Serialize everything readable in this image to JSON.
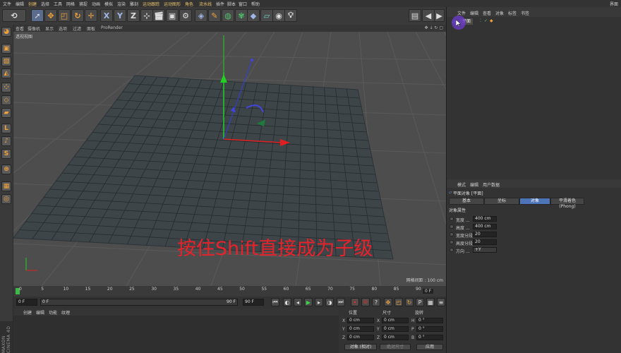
{
  "menu": {
    "items": [
      "文件",
      "编辑",
      "创建",
      "选择",
      "工具",
      "网格",
      "捕捉",
      "动画",
      "模拟",
      "渲染",
      "雕刻",
      "运动跟踪",
      "运动图形",
      "角色",
      "流水线",
      "插件",
      "脚本",
      "窗口",
      "帮助"
    ],
    "layout_label": "界面"
  },
  "toolbar": {
    "undo": "⟲",
    "x": "X",
    "y": "Y",
    "z": "Z"
  },
  "viewport": {
    "menu": [
      "查看",
      "摄像机",
      "显示",
      "选项",
      "过滤",
      "面板",
      "ProRender"
    ],
    "label": "透视视图",
    "grid_spacing": "网格间距 : 100 cm",
    "caption": "按住Shift直接成为子级"
  },
  "timeline": {
    "ticks": [
      "0",
      "5",
      "10",
      "15",
      "20",
      "25",
      "30",
      "35",
      "40",
      "45",
      "50",
      "55",
      "60",
      "65",
      "70",
      "75",
      "80",
      "85",
      "90"
    ],
    "end_frame": "0 F"
  },
  "playback": {
    "current": "0 F",
    "start": "0 F",
    "end": "90 F",
    "max": "90 F"
  },
  "material_manager": {
    "menu": [
      "创建",
      "编辑",
      "功能",
      "纹理"
    ]
  },
  "coordinates": {
    "headers": [
      "位置",
      "尺寸",
      "旋转"
    ],
    "rows": [
      {
        "axis": "X",
        "pos": "0 cm",
        "size_axis": "X",
        "size": "0 cm",
        "rot_axis": "H",
        "rot": "0 °"
      },
      {
        "axis": "Y",
        "pos": "0 cm",
        "size_axis": "Y",
        "size": "0 cm",
        "rot_axis": "P",
        "rot": "0 °"
      },
      {
        "axis": "Z",
        "pos": "0 cm",
        "size_axis": "Z",
        "size": "0 cm",
        "rot_axis": "B",
        "rot": "0 °"
      }
    ],
    "mode": "对象 (相对)",
    "size_mode": "绝对尺寸",
    "apply": "应用"
  },
  "object_manager": {
    "menu": [
      "文件",
      "编辑",
      "查看",
      "对象",
      "标签",
      "书签"
    ],
    "object_name": "平面"
  },
  "attribute_manager": {
    "menu": [
      "模式",
      "编辑",
      "用户数据"
    ],
    "title": "平面对象 [平面]",
    "tabs": [
      "基本",
      "坐标",
      "对象",
      "平滑着色(Phong)"
    ],
    "section": "对象属性",
    "rows": [
      {
        "label": "宽度 ...",
        "value": "400 cm"
      },
      {
        "label": "高度 ...",
        "value": "400 cm"
      },
      {
        "label": "宽度分段",
        "value": "20"
      },
      {
        "label": "高度分段",
        "value": "20"
      },
      {
        "label": "方向 ...",
        "value": "+Y"
      }
    ]
  },
  "branding": "MAXON CINEMA 4D",
  "colors": {
    "accent": "#4d74b6",
    "caption": "#e8222a",
    "axis_x": "#e02020",
    "axis_y": "#20d020",
    "axis_z": "#3040e0"
  }
}
